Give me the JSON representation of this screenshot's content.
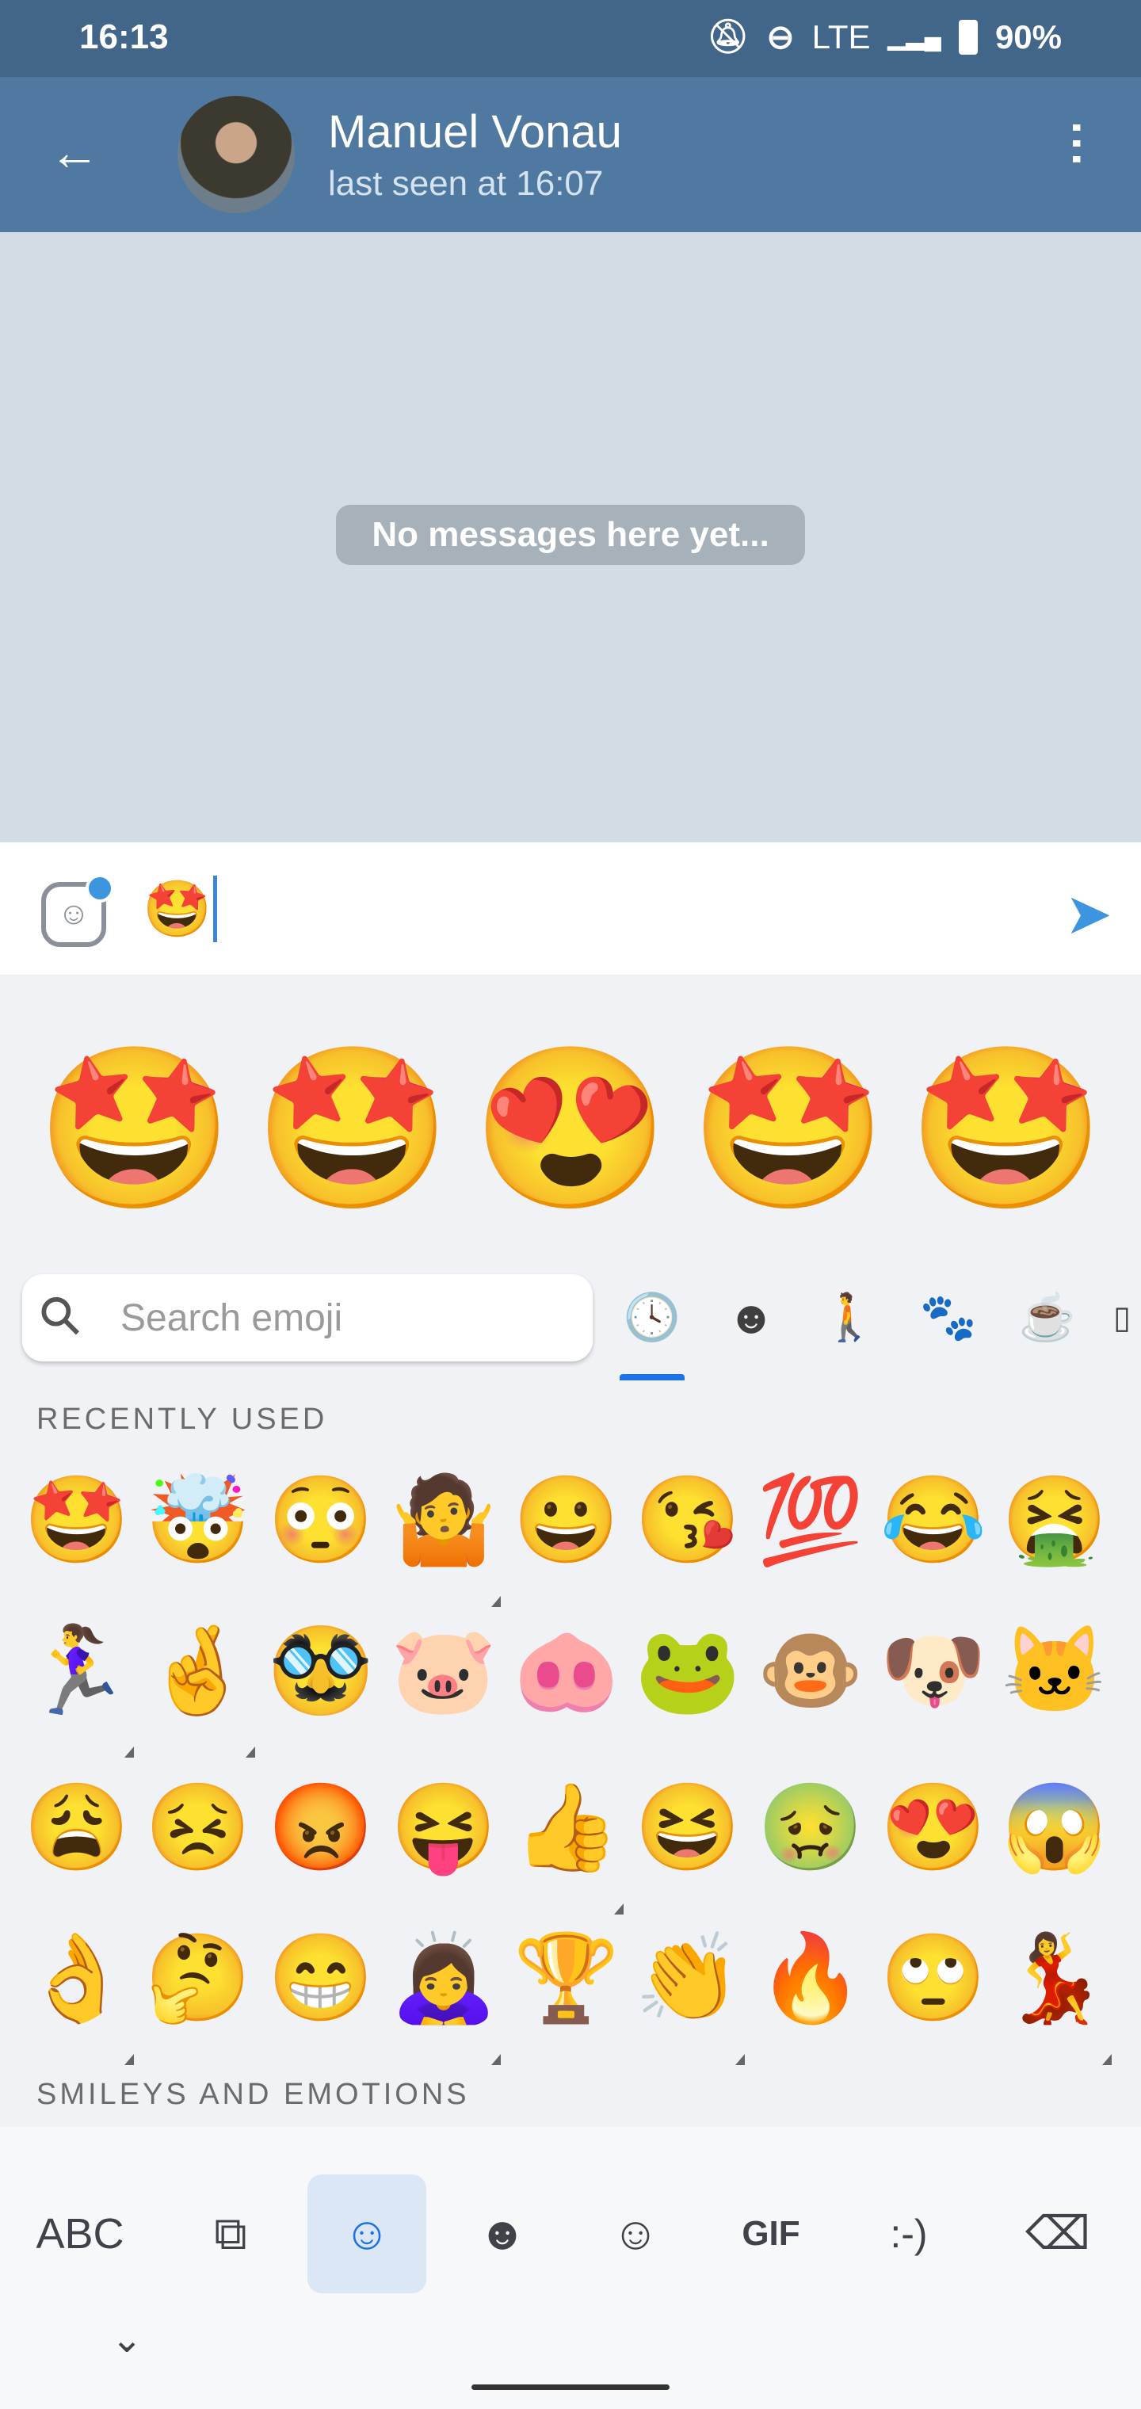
{
  "status": {
    "time": "16:13",
    "icons": [
      "bell-off-icon",
      "dnd-icon"
    ],
    "network": "LTE",
    "battery": "90%"
  },
  "header": {
    "name": "Manuel Vonau",
    "subtitle": "last seen at 16:07"
  },
  "chat": {
    "empty_text": "No messages here yet..."
  },
  "input": {
    "value": "🤩"
  },
  "suggestions": [
    "🤩",
    "🤩",
    "😍",
    "🤩",
    "🤩"
  ],
  "search": {
    "placeholder": "Search emoji"
  },
  "tabs": [
    "🕓",
    "☻",
    "🚶",
    "🐾",
    "☕",
    "▯"
  ],
  "sections": {
    "recent": "RECENTLY USED",
    "smileys": "SMILEYS AND EMOTIONS"
  },
  "recent": [
    [
      "🤩",
      "🤯",
      "😳",
      "🤷",
      "😀",
      "😘",
      "💯",
      "😂",
      "🤮"
    ],
    [
      "🏃‍♀️",
      "🤞",
      "🥸",
      "🐷",
      "🐽",
      "🐸",
      "🐵",
      "🐶",
      "🐱"
    ],
    [
      "😩",
      "😣",
      "😡",
      "😝",
      "👍",
      "😆",
      "🤢",
      "😍",
      "😱"
    ],
    [
      "👌",
      "🤔",
      "😁",
      "🙇‍♀️",
      "🏆",
      "👏",
      "🔥",
      "🙄",
      "💃"
    ]
  ],
  "keyboard": {
    "abc": "ABC",
    "gif": "GIF",
    "emoticon": ":-)"
  }
}
